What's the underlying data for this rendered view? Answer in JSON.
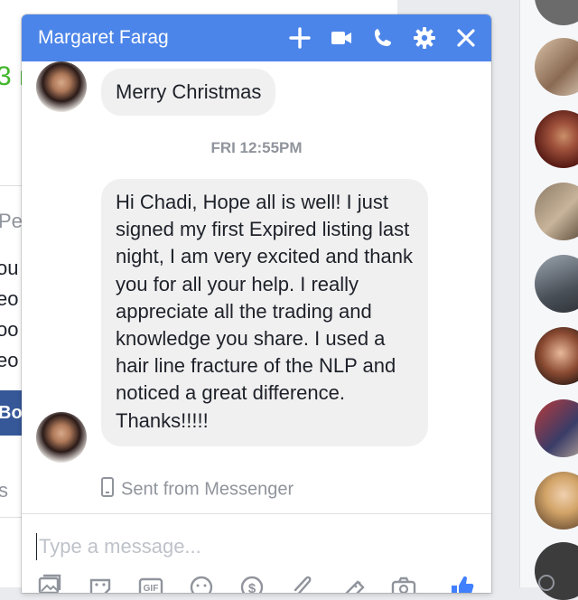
{
  "background_page": {
    "green_fragment": "3 r",
    "pe_fragment": "Pe",
    "line_fragments": [
      "ou",
      "eo",
      "oo",
      "eo"
    ],
    "button_fragment": "Bo",
    "s_fragment": "s"
  },
  "chat": {
    "title": "Margaret Farag",
    "header_icons": [
      "plus-icon",
      "video-camera-icon",
      "phone-icon",
      "gear-icon",
      "close-icon"
    ],
    "messages": [
      {
        "text": "Merry Christmas"
      },
      {
        "text": "Hi Chadi, Hope all is well! I just signed  my first Expired listing last night, I am very excited and thank you for all your help. I really appreciate all the trading and knowledge you share. I used a hair line fracture of the NLP and noticed a great difference. Thanks!!!!!"
      }
    ],
    "timestamp": "FRI 12:55PM",
    "sent_from": "Sent from Messenger",
    "composer_placeholder": "Type a message...",
    "toolbar_icons": [
      "photo-icon",
      "sticker-icon",
      "gif-icon",
      "emoji-icon",
      "payment-icon",
      "attachment-icon",
      "game-icon",
      "camera-icon",
      "like-icon"
    ]
  },
  "colors": {
    "header": "#4c85e9",
    "bubble": "#f1f0f0",
    "accent": "#4080ff"
  }
}
